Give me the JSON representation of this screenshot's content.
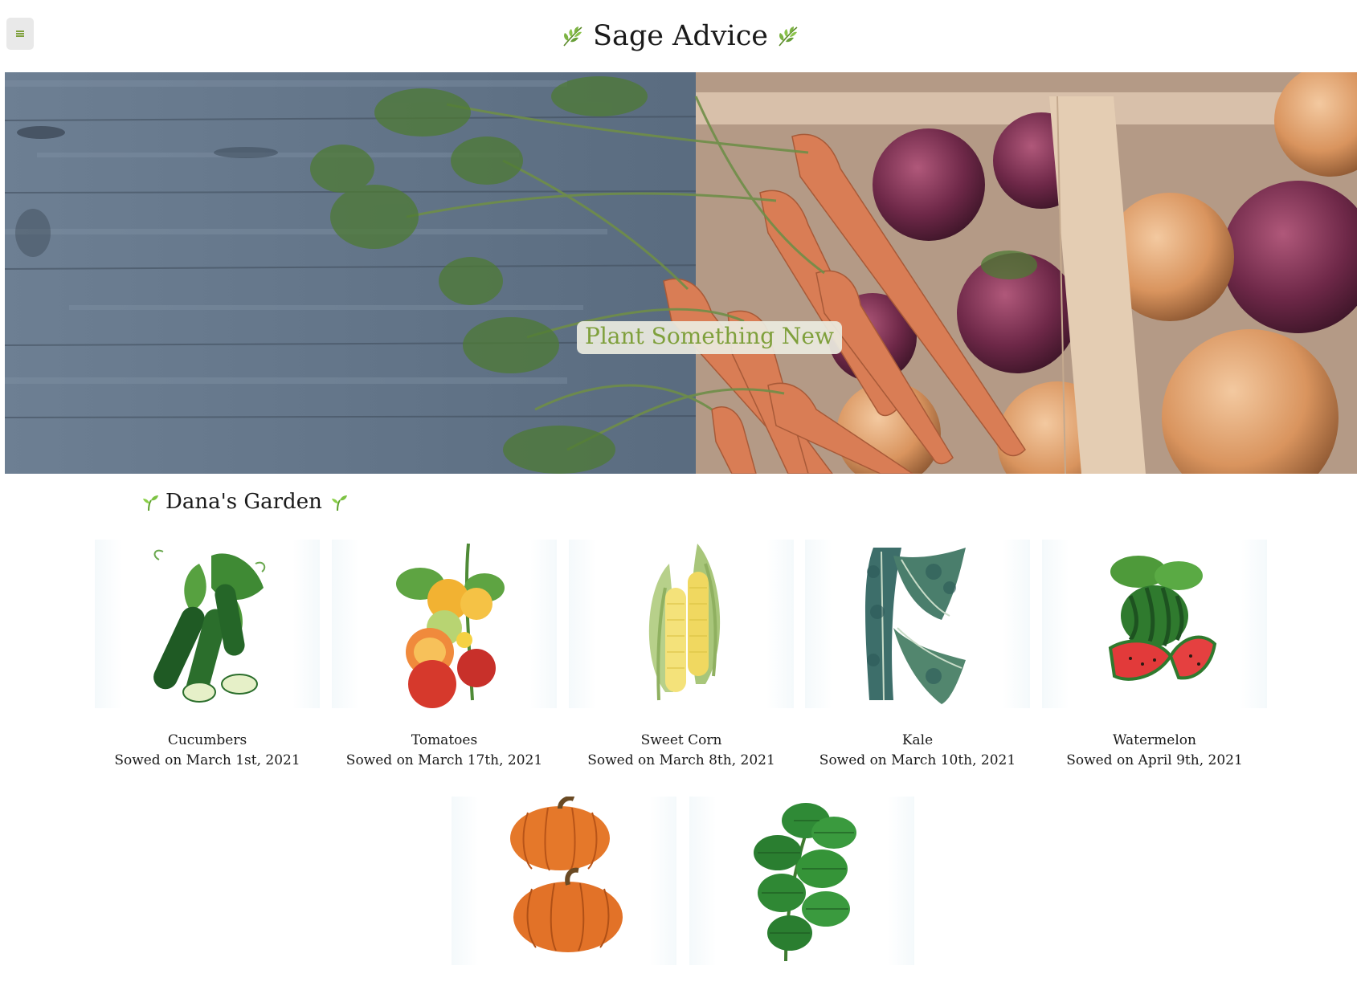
{
  "header": {
    "title": "Sage Advice",
    "menu_icon": "hamburger-menu-icon",
    "title_icon": "herb-leaf-icon"
  },
  "hero": {
    "label": "Plant Something New",
    "image": "carrots-and-onions-basket-photo"
  },
  "garden": {
    "title": "Dana's Garden",
    "title_icon": "seedling-icon",
    "plants": [
      {
        "name": "Cucumbers",
        "sowed": "Sowed on March 1st, 2021",
        "icon": "cucumber-illustration"
      },
      {
        "name": "Tomatoes",
        "sowed": "Sowed on March 17th, 2021",
        "icon": "tomato-illustration"
      },
      {
        "name": "Sweet Corn",
        "sowed": "Sowed on March 8th, 2021",
        "icon": "corn-illustration"
      },
      {
        "name": "Kale",
        "sowed": "Sowed on March 10th, 2021",
        "icon": "kale-illustration"
      },
      {
        "name": "Watermelon",
        "sowed": "Sowed on April 9th, 2021",
        "icon": "watermelon-illustration"
      },
      {
        "name": "",
        "sowed": "",
        "icon": "pumpkin-illustration"
      },
      {
        "name": "",
        "sowed": "",
        "icon": "basil-illustration"
      }
    ]
  },
  "colors": {
    "accent_green": "#7fa03c",
    "menu_bg": "#e9e9e9",
    "hero_label_bg": "#ebebe1"
  }
}
